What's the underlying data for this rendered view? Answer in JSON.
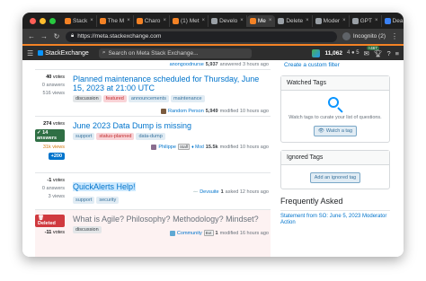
{
  "browser": {
    "tabs": [
      {
        "label": "Stack",
        "fav": "#f48225"
      },
      {
        "label": "The M",
        "fav": "#f48225"
      },
      {
        "label": "Charo",
        "fav": "#f48225"
      },
      {
        "label": "(1) Met",
        "fav": "#f48225"
      },
      {
        "label": "Develo",
        "fav": "#9aa0a6"
      },
      {
        "label": "Me",
        "fav": "#f48225"
      },
      {
        "label": "Delete",
        "fav": "#9aa0a6"
      },
      {
        "label": "Moder",
        "fav": "#9aa0a6"
      },
      {
        "label": "GPT",
        "fav": "#9aa0a6"
      },
      {
        "label": "Dear S",
        "fav": "#3b82f6"
      }
    ],
    "url": "https://meta.stackexchange.com",
    "profile_label": "Incognito (2)"
  },
  "site": {
    "logo_text": "StackExchange",
    "search_placeholder": "Search on Meta Stack Exchange...",
    "reputation": "11,062",
    "badges": "4 ● 5",
    "inbox_count": "+467"
  },
  "questions_top": {
    "user": "anongoodnurse",
    "rep": "5,937",
    "action": "answered 3 hours ago"
  },
  "questions": [
    {
      "votes": "40",
      "votes_label": "votes",
      "answers": "0 answers",
      "views": "516 views",
      "title": "Planned maintenance scheduled for Thursday, June 15, 2023 at 21:00 UTC",
      "tags": [
        {
          "label": "discussion",
          "style": "gray"
        },
        {
          "label": "featured",
          "style": "red"
        },
        {
          "label": "announcements",
          "style": "blue"
        },
        {
          "label": "maintenance",
          "style": "blue"
        }
      ],
      "user": "Random Person",
      "rep": "5,949",
      "action": "modified 10 hours ago"
    },
    {
      "votes": "274",
      "votes_label": "votes",
      "answers": "14 answers",
      "views": "31k views",
      "bounty": "+200",
      "title": "June 2023 Data Dump is missing",
      "tags": [
        {
          "label": "support",
          "style": "blue"
        },
        {
          "label": "status-planned",
          "style": "red"
        },
        {
          "label": "data-dump",
          "style": "blue"
        }
      ],
      "user": "Philippe",
      "staff": "Staff",
      "mod": "♦ Mod",
      "rep": "15.5k",
      "action": "modified 10 hours ago"
    },
    {
      "votes": "-1",
      "votes_label": "votes",
      "answers": "0 answers",
      "views": "3 views",
      "title": "QuickAlerts Help!",
      "tags": [
        {
          "label": "support",
          "style": "blue"
        },
        {
          "label": "security",
          "style": "blue"
        }
      ],
      "user": "Devsuite",
      "rep": "1",
      "action": "asked 12 hours ago"
    },
    {
      "deleted_label": "Deleted",
      "votes": "-11",
      "votes_label": "votes",
      "title": "What is Agile? Philosophy? Methodology? Mindset?",
      "tags": [
        {
          "label": "discussion",
          "style": "gray"
        }
      ],
      "user": "Community",
      "bot": "Bot",
      "rep": "1",
      "action": "modified 16 hours ago"
    }
  ],
  "sidebar": {
    "custom_filter": "Create a custom filter",
    "watched_title": "Watched Tags",
    "watched_text": "Watch tags to curate your list of questions.",
    "watch_button": "Watch a tag",
    "ignored_title": "Ignored Tags",
    "ignore_button": "Add an ignored tag",
    "faq_title": "Frequently Asked",
    "faq_link": "Statement from SO: June 5, 2023 Moderator Action"
  },
  "colors": {
    "accent": "#f48225",
    "link": "#0074cc",
    "answered": "#2f6f44",
    "deleted": "#d0393e"
  }
}
